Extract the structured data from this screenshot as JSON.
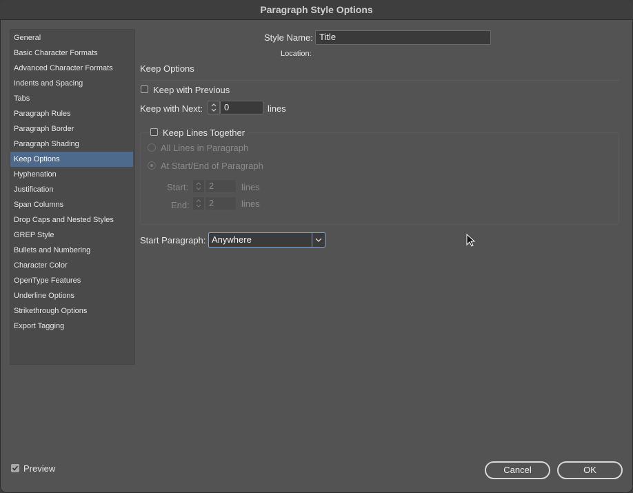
{
  "window": {
    "title": "Paragraph Style Options"
  },
  "sidebar": {
    "items": [
      {
        "label": "General"
      },
      {
        "label": "Basic Character Formats"
      },
      {
        "label": "Advanced Character Formats"
      },
      {
        "label": "Indents and Spacing"
      },
      {
        "label": "Tabs"
      },
      {
        "label": "Paragraph Rules"
      },
      {
        "label": "Paragraph Border"
      },
      {
        "label": "Paragraph Shading"
      },
      {
        "label": "Keep Options",
        "selected": true
      },
      {
        "label": "Hyphenation"
      },
      {
        "label": "Justification"
      },
      {
        "label": "Span Columns"
      },
      {
        "label": "Drop Caps and Nested Styles"
      },
      {
        "label": "GREP Style"
      },
      {
        "label": "Bullets and Numbering"
      },
      {
        "label": "Character Color"
      },
      {
        "label": "OpenType Features"
      },
      {
        "label": "Underline Options"
      },
      {
        "label": "Strikethrough Options"
      },
      {
        "label": "Export Tagging"
      }
    ]
  },
  "header": {
    "style_name_label": "Style Name:",
    "style_name_value": "Title",
    "location_label": "Location:"
  },
  "section": {
    "title": "Keep Options"
  },
  "keep": {
    "keep_with_previous_label": "Keep with Previous",
    "keep_with_previous_checked": false,
    "keep_with_next_label": "Keep with Next:",
    "keep_with_next_value": "0",
    "keep_with_next_unit": "lines",
    "keep_lines_together_label": "Keep Lines Together",
    "keep_lines_together_checked": false,
    "all_lines_label": "All Lines in Paragraph",
    "at_start_end_label": "At Start/End of Paragraph",
    "start_label": "Start:",
    "start_value": "2",
    "start_unit": "lines",
    "end_label": "End:",
    "end_value": "2",
    "end_unit": "lines"
  },
  "start_paragraph": {
    "label": "Start Paragraph:",
    "value": "Anywhere"
  },
  "footer": {
    "preview_label": "Preview",
    "preview_checked": true,
    "cancel_label": "Cancel",
    "ok_label": "OK"
  }
}
